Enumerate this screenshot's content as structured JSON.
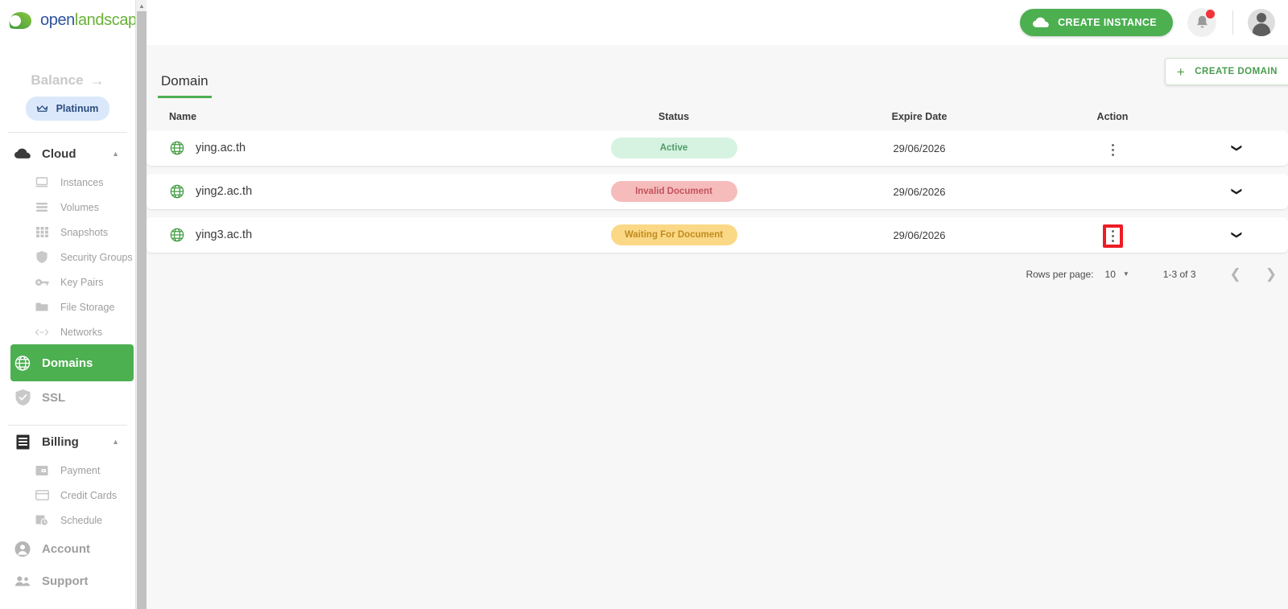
{
  "brand": {
    "logo_open": "open",
    "logo_land": "landscape",
    "logo_icon": "leaf-logo-icon"
  },
  "sidebar": {
    "balance": {
      "label": "Balance",
      "arrow_icon": "arrow-right-icon"
    },
    "plan": {
      "label": "Platinum",
      "icon": "crown-icon"
    },
    "groups": [
      {
        "label": "Cloud",
        "icon": "cloud-icon",
        "chevron": "chevron-up-icon",
        "items": [
          {
            "label": "Instances",
            "icon": "monitor-icon"
          },
          {
            "label": "Volumes",
            "icon": "stack-icon"
          },
          {
            "label": "Snapshots",
            "icon": "grid-icon"
          },
          {
            "label": "Security Groups",
            "icon": "shield-icon"
          },
          {
            "label": "Key Pairs",
            "icon": "key-icon"
          },
          {
            "label": "File Storage",
            "icon": "folder-icon"
          },
          {
            "label": "Networks",
            "icon": "code-brackets-icon"
          }
        ]
      }
    ],
    "domains": {
      "label": "Domains",
      "icon": "globe-icon",
      "active": true
    },
    "ssl": {
      "label": "SSL",
      "icon": "shield-check-icon"
    },
    "billing": {
      "label": "Billing",
      "icon": "receipt-icon",
      "chevron": "chevron-up-icon",
      "items": [
        {
          "label": "Payment",
          "icon": "wallet-icon"
        },
        {
          "label": "Credit Cards",
          "icon": "credit-card-icon"
        },
        {
          "label": "Schedule",
          "icon": "calendar-clock-icon"
        }
      ]
    },
    "account": {
      "label": "Account",
      "icon": "person-circle-icon"
    },
    "support": {
      "label": "Support",
      "icon": "people-icon"
    }
  },
  "topbar": {
    "create_instance_label": "CREATE INSTANCE",
    "create_instance_icon": "cloud-icon",
    "bell_icon": "bell-icon",
    "avatar_icon": "avatar-icon"
  },
  "page": {
    "tab_label": "Domain",
    "create_domain_label": "CREATE DOMAIN",
    "create_domain_icon": "plus-icon"
  },
  "table": {
    "headers": {
      "name": "Name",
      "status": "Status",
      "expire_date": "Expire Date",
      "action": "Action"
    },
    "rows": [
      {
        "name": "ying.ac.th",
        "icon": "globe-icon",
        "status": "Active",
        "status_kind": "active",
        "expire_date": "29/06/2026",
        "has_action_menu": true,
        "action_highlighted": false,
        "expand_icon": "chevron-down-icon"
      },
      {
        "name": "ying2.ac.th",
        "icon": "globe-icon",
        "status": "Invalid Document",
        "status_kind": "invalid",
        "expire_date": "29/06/2026",
        "has_action_menu": false,
        "action_highlighted": false,
        "expand_icon": "chevron-down-icon"
      },
      {
        "name": "ying3.ac.th",
        "icon": "globe-icon",
        "status": "Waiting For Document",
        "status_kind": "waiting",
        "expire_date": "29/06/2026",
        "has_action_menu": true,
        "action_highlighted": true,
        "expand_icon": "chevron-down-icon"
      }
    ]
  },
  "pagination": {
    "rows_per_page_label": "Rows per page:",
    "rows_per_page_value": "10",
    "range": "1-3 of 3",
    "prev_icon": "chevron-left-icon",
    "next_icon": "chevron-right-icon"
  },
  "colors": {
    "brand_green": "#4caf50",
    "logo_blue": "#2f52a0",
    "badge_active_bg": "#d6f2e0",
    "badge_invalid_bg": "#f6bcbc",
    "badge_waiting_bg": "#fbd886",
    "highlight_red": "#ee1c24"
  }
}
